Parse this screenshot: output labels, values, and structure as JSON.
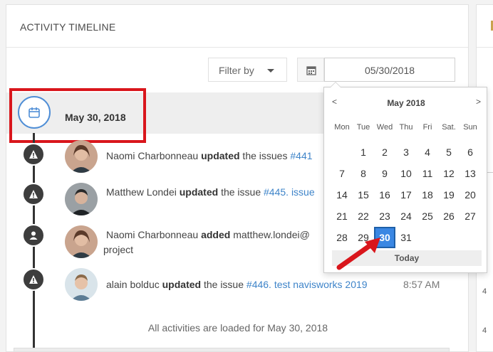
{
  "panel": {
    "title": "ACTIVITY TIMELINE"
  },
  "filter": {
    "label": "Filter by"
  },
  "date_input": {
    "value": "05/30/2018"
  },
  "day_group": {
    "label": "May 30, 2018"
  },
  "entries": [
    {
      "user": "Naomi Charbonneau",
      "verb": "updated",
      "mid": " the issues ",
      "link": "#441",
      "sub": "",
      "time": ""
    },
    {
      "user": "Matthew Londei",
      "verb": "updated",
      "mid": " the issue ",
      "link": "#445. issue",
      "sub": "",
      "time": ""
    },
    {
      "user": "Naomi Charbonneau",
      "verb": "added",
      "mid": " matthew.londei@",
      "link": "",
      "sub": "project",
      "time": ""
    },
    {
      "user": "alain bolduc",
      "verb": "updated",
      "mid": " the issue ",
      "link": "#446. test navisworks 2019",
      "sub": "",
      "time": "8:57 AM"
    }
  ],
  "footer": {
    "note": "All activities are loaded for May 30, 2018"
  },
  "datepicker": {
    "prev": "<",
    "next": ">",
    "title": "May 2018",
    "weekdays": [
      "Mon",
      "Tue",
      "Wed",
      "Thu",
      "Fri",
      "Sat.",
      "Sun"
    ],
    "weeks": [
      [
        "",
        "1",
        "2",
        "3",
        "4",
        "5",
        "6"
      ],
      [
        "7",
        "8",
        "9",
        "10",
        "11",
        "12",
        "13"
      ],
      [
        "14",
        "15",
        "16",
        "17",
        "18",
        "19",
        "20"
      ],
      [
        "21",
        "22",
        "23",
        "24",
        "25",
        "26",
        "27"
      ],
      [
        "28",
        "29",
        "30",
        "31",
        "",
        "",
        ""
      ]
    ],
    "selected_day": "30",
    "today_label": "Today"
  },
  "right_panel": {
    "numbers": [
      "4",
      "4"
    ]
  },
  "colors": {
    "accent": "#3a87e3",
    "highlight": "#d9161c",
    "link": "#3e84c9"
  }
}
